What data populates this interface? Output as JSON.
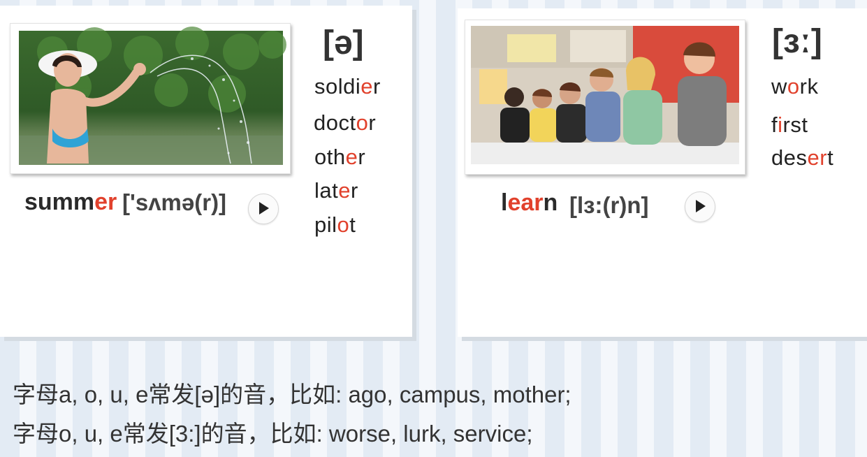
{
  "left_card": {
    "ipa": "[ə]",
    "words": [
      {
        "pre": "soldi",
        "hl": "e",
        "post": "r"
      },
      {
        "pre": "doct",
        "hl": "o",
        "post": "r"
      },
      {
        "pre": "oth",
        "hl": "e",
        "post": "r"
      },
      {
        "pre": "lat",
        "hl": "e",
        "post": "r"
      },
      {
        "pre": "pil",
        "hl": "o",
        "post": "t"
      }
    ],
    "headword_pre": "summ",
    "headword_hl": "er",
    "transcript": "['sʌmə(r)]",
    "play_icon": "play-icon"
  },
  "right_card": {
    "ipa": "[ɜː]",
    "words": [
      {
        "pre": "w",
        "hl": "o",
        "post": "rk"
      },
      {
        "pre": "f",
        "hl": "i",
        "post": "rst"
      },
      {
        "pre": "des",
        "hl": "er",
        "post": "t"
      }
    ],
    "headword_pre": "l",
    "headword_hl": "ear",
    "headword_post": "n",
    "transcript": "[lɜ:(r)n]",
    "play_icon": "play-icon"
  },
  "notes": [
    "字母a, o, u, e常发[ə]的音，比如: ago, campus, mother;",
    "字母o, u, e常发[3:]的音，比如: worse, lurk, service;"
  ],
  "colors": {
    "highlight": "#e1412c",
    "text": "#222222"
  }
}
